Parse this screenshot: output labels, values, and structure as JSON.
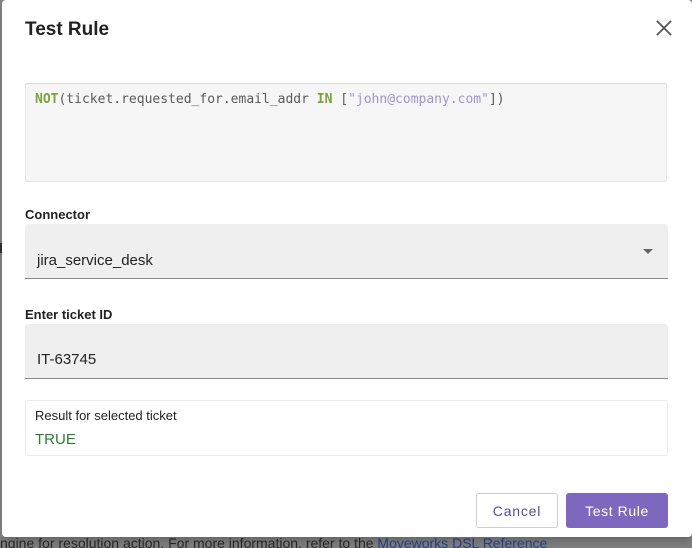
{
  "dialog": {
    "title": "Test Rule",
    "close_icon": "close-icon"
  },
  "rule_editor": {
    "tokens": [
      {
        "type": "keyword",
        "text": "NOT"
      },
      {
        "type": "plain",
        "text": "(ticket.requested_for.email_addr "
      },
      {
        "type": "keyword",
        "text": "IN"
      },
      {
        "type": "plain",
        "text": " ["
      },
      {
        "type": "string",
        "text": "\"john@company.com\""
      },
      {
        "type": "plain",
        "text": "])"
      }
    ]
  },
  "connector": {
    "label": "Connector",
    "value": "jira_service_desk",
    "dropdown_icon": "caret-down-icon"
  },
  "ticket": {
    "label": "Enter ticket ID",
    "value": "IT-63745"
  },
  "result": {
    "label": "Result for selected ticket",
    "value": "TRUE"
  },
  "actions": {
    "cancel_label": "Cancel",
    "test_label": "Test Rule"
  },
  "background": {
    "text": "ngine for resolution action. For more information, refer to the",
    "link_text": "Moveworks DSL Reference"
  },
  "colors": {
    "primary": "#7e68bf",
    "keyword": "#7aa33b",
    "string": "#a98fd0",
    "result_true": "#2e7d32"
  }
}
